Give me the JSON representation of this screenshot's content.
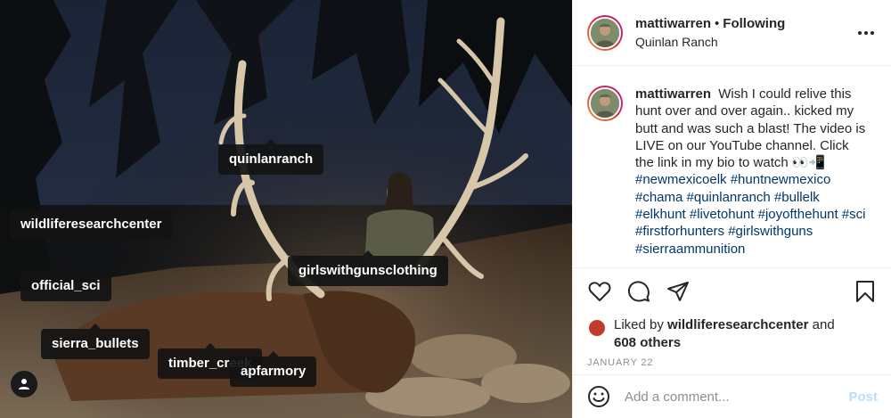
{
  "post": {
    "username": "mattiwarren",
    "separator": "•",
    "follow_status": "Following",
    "location": "Quinlan Ranch",
    "caption_text": "Wish I could relive this hunt over and over again.. kicked my butt and was such a blast! The video is LIVE on our YouTube channel. Click the link in my bio to watch 👀📲",
    "hashtags": "#newmexicoelk #huntnewmexico #chama #quinlanranch #bullelk #elkhunt #livetohunt #joyofthehunt #sci #firstforhunters #girlswithguns #sierraammunition"
  },
  "photo_tags": [
    {
      "label": "quinlanranch"
    },
    {
      "label": "wildliferesearchcenter"
    },
    {
      "label": "girlswithgunsclothing"
    },
    {
      "label": "official_sci"
    },
    {
      "label": "sierra_bullets"
    },
    {
      "label": "timber_creek"
    },
    {
      "label": "apfarmory"
    }
  ],
  "likes": {
    "prefix": "Liked by",
    "user": "wildliferesearchcenter",
    "and": "and",
    "others": "608 others"
  },
  "date": "JANUARY 22",
  "comment": {
    "placeholder": "Add a comment...",
    "post_label": "Post"
  },
  "icons": {
    "more": "more-options-icon",
    "like": "heart-icon",
    "comment": "comment-icon",
    "share": "share-icon",
    "save": "bookmark-icon",
    "emoji": "emoji-icon",
    "user_tags": "user-tag-icon"
  },
  "colors": {
    "hashtag": "#00376b",
    "post_button_disabled": "#b2dffc",
    "muted": "#8e8e8e"
  }
}
